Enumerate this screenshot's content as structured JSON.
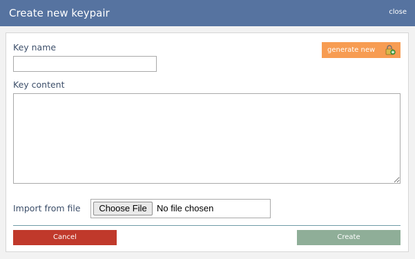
{
  "dialog": {
    "title": "Create new keypair",
    "close_label": "close",
    "colors": {
      "titlebar": "#5673a0",
      "generate_button": "#f79c52",
      "cancel_button": "#c0392b",
      "create_button": "#8fae98"
    }
  },
  "form": {
    "key_name_label": "Key name",
    "key_name_value": "",
    "generate_label": "generate new",
    "generate_icon": "key-lock-icon",
    "key_content_label": "Key content",
    "key_content_value": "",
    "import_label": "Import from file",
    "choose_file_label": "Choose File",
    "file_status": "No file chosen"
  },
  "actions": {
    "cancel_label": "Cancel",
    "create_label": "Create"
  }
}
